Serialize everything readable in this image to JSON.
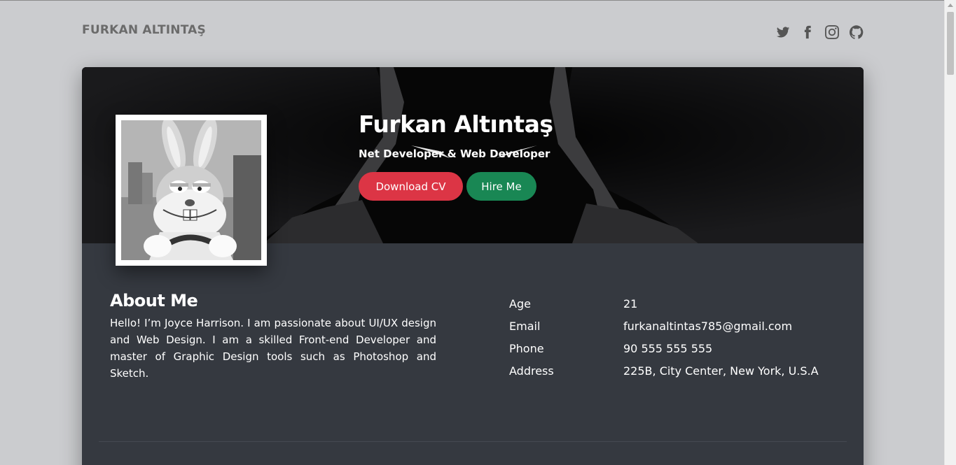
{
  "header": {
    "brand": "FURKAN ALTINTAŞ",
    "socials": [
      {
        "icon": "twitter-icon"
      },
      {
        "icon": "facebook-icon"
      },
      {
        "icon": "instagram-icon"
      },
      {
        "icon": "github-icon"
      }
    ]
  },
  "hero": {
    "name": "Furkan Altıntaş",
    "role": "Net Developer & Web Developer",
    "download_label": "Download CV",
    "hire_label": "Hire Me"
  },
  "about": {
    "title": "About Me",
    "text": "Hello! I’m Joyce Harrison. I am passionate about UI/UX design and Web Design. I am a skilled Front-end Developer and master of Graphic Design tools such as Photoshop and Sketch."
  },
  "info": [
    {
      "label": "Age",
      "value": "21"
    },
    {
      "label": "Email",
      "value": "furkanaltintas785@gmail.com"
    },
    {
      "label": "Phone",
      "value": "90 555 555 555"
    },
    {
      "label": "Address",
      "value": "225B, City Center, New York, U.S.A"
    }
  ],
  "colors": {
    "background": "#cbcccf",
    "card": "#353940",
    "download_button": "#dc3545",
    "hire_button": "#198754"
  }
}
